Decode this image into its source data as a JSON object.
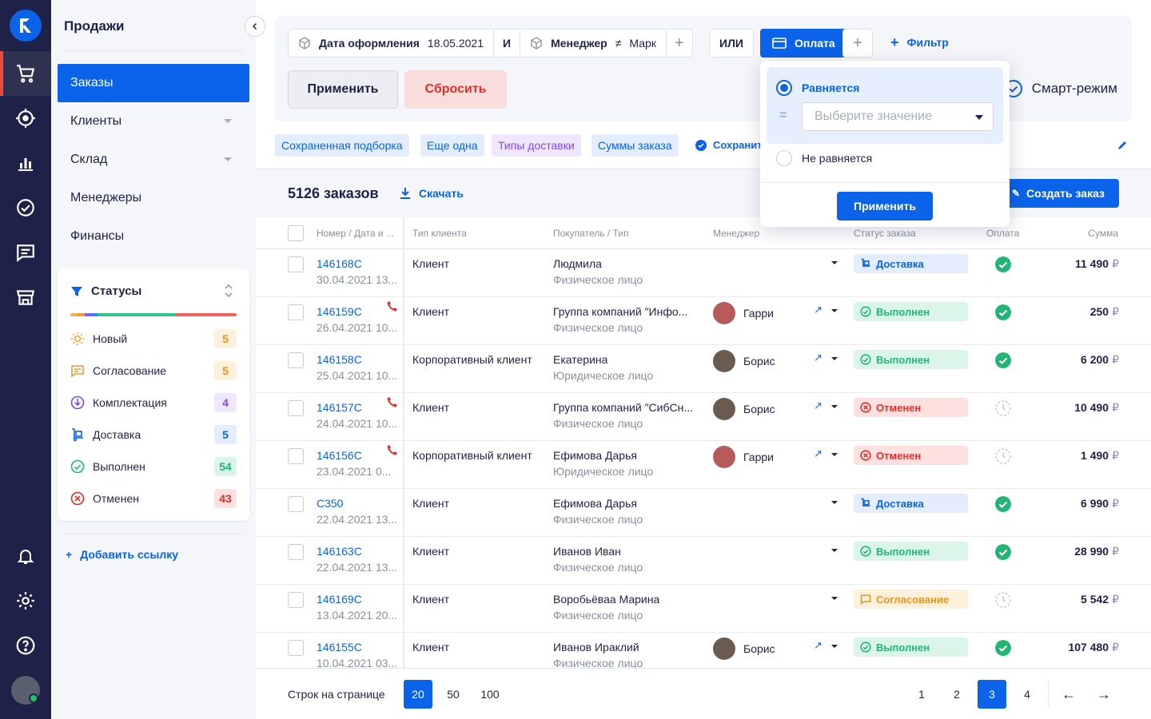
{
  "sidebar": {
    "title": "Продажи",
    "nav": [
      {
        "label": "Заказы"
      },
      {
        "label": "Клиенты"
      },
      {
        "label": "Склад"
      },
      {
        "label": "Менеджеры"
      },
      {
        "label": "Финансы"
      }
    ],
    "statuses_title": "Статусы",
    "statuses": [
      {
        "label": "Новый",
        "count": "5"
      },
      {
        "label": "Согласование",
        "count": "5"
      },
      {
        "label": "Комплектация",
        "count": "4"
      },
      {
        "label": "Доставка",
        "count": "5"
      },
      {
        "label": "Выполнен",
        "count": "54"
      },
      {
        "label": "Отменен",
        "count": "43"
      }
    ],
    "add_link": "Добавить ссылку"
  },
  "filters": {
    "chip1_field": "Дата оформления",
    "chip1_value": "18.05.2021",
    "and": "И",
    "chip2_field": "Менеджер",
    "chip2_op": "≠",
    "chip2_value": "Марк",
    "or": "ИЛИ",
    "chip3_field": "Оплата",
    "add_filter": "Фильтр",
    "apply": "Применить",
    "reset": "Сбросить",
    "smart": "Смарт-режим",
    "saved": [
      "Сохраненная подборка",
      "Еще одна",
      "Типы доставки",
      "Суммы заказа"
    ],
    "save_label": "Сохранить"
  },
  "popover": {
    "equals": "Равняется",
    "eq_sign": "=",
    "placeholder": "Выберите значение",
    "not_equals": "Не равняется",
    "apply": "Применить"
  },
  "list": {
    "count": "5126 заказов",
    "download": "Скачать",
    "create": "Создать заказ",
    "headers": {
      "num": "Номер / Дата и ...",
      "type": "Тип клиента",
      "buyer": "Покупатель / Тип",
      "manager": "Менеджер",
      "status": "Статус заказа",
      "pay": "Оплата",
      "sum": "Сумма"
    },
    "currency": "₽",
    "rows": [
      {
        "num": "146168C",
        "date": "30.04.2021 13...",
        "type": "Клиент",
        "buyer": "Людмила",
        "btype": "Физическое лицо",
        "mgr": "",
        "status": "Доставка",
        "paid": true,
        "sum": "11 490"
      },
      {
        "num": "146159C",
        "date": "26.04.2021 10...",
        "type": "Клиент",
        "buyer": "Группа компаний \"Инфо...",
        "btype": "Физическое лицо",
        "mgr": "Гарри",
        "status": "Выполнен",
        "paid": true,
        "sum": "250"
      },
      {
        "num": "146158C",
        "date": "25.04.2021 10...",
        "type": "Корпоративный клиент",
        "buyer": "Екатерина",
        "btype": "Юридическое лицо",
        "mgr": "Борис",
        "status": "Выполнен",
        "paid": true,
        "sum": "6 200"
      },
      {
        "num": "146157C",
        "date": "24.04.2021 10...",
        "type": "Клиент",
        "buyer": "Группа компаний \"СибСн...",
        "btype": "Физическое лицо",
        "mgr": "Борис",
        "status": "Отменен",
        "paid": false,
        "sum": "10 490"
      },
      {
        "num": "146156C",
        "date": "23.04.2021 0...",
        "type": "Корпоративный клиент",
        "buyer": "Ефимова Дарья",
        "btype": "Юридическое лицо",
        "mgr": "Гарри",
        "status": "Отменен",
        "paid": false,
        "sum": "1 490"
      },
      {
        "num": "C350",
        "date": "22.04.2021 13...",
        "type": "Клиент",
        "buyer": "Ефимова Дарья",
        "btype": "Физическое лицо",
        "mgr": "",
        "status": "Доставка",
        "paid": true,
        "sum": "6 990"
      },
      {
        "num": "146163C",
        "date": "22.04.2021 13...",
        "type": "Клиент",
        "buyer": "Иванов Иван",
        "btype": "Физическое лицо",
        "mgr": "",
        "status": "Выполнен",
        "paid": true,
        "sum": "28 990"
      },
      {
        "num": "146169C",
        "date": "13.04.2021 20...",
        "type": "Клиент",
        "buyer": "Воробьёваа Марина",
        "btype": "Физическое лицо",
        "mgr": "",
        "status": "Согласование",
        "paid": false,
        "sum": "5 542"
      },
      {
        "num": "146155C",
        "date": "10.04.2021 03...",
        "type": "Клиент",
        "buyer": "Иванов Ираклий",
        "btype": "Физическое лицо",
        "mgr": "Борис",
        "status": "Выполнен",
        "paid": true,
        "sum": "107 480"
      }
    ]
  },
  "footer": {
    "rows_label": "Строк на странице",
    "sizes": [
      "20",
      "50",
      "100"
    ],
    "pages": [
      "1",
      "2",
      "3",
      "4"
    ],
    "prev": "←",
    "next": "→"
  },
  "colors": {
    "accent": "#0a63e8",
    "rail": "#1e2248",
    "danger": "#e0302a",
    "success": "#22b573"
  }
}
